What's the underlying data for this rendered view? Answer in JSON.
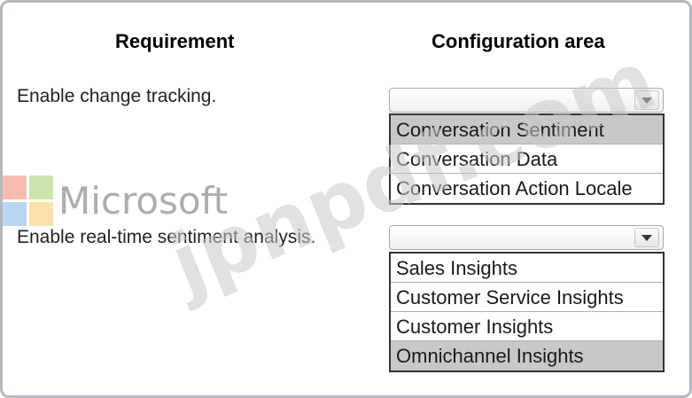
{
  "headers": {
    "requirement": "Requirement",
    "configuration": "Configuration area"
  },
  "rows": [
    {
      "requirement": "Enable change tracking.",
      "dropdown_value": "",
      "options": [
        {
          "label": "Conversation Sentiment",
          "selected": true
        },
        {
          "label": "Conversation Data",
          "selected": false
        },
        {
          "label": "Conversation Action Locale",
          "selected": false
        }
      ]
    },
    {
      "requirement": "Enable real-time sentiment analysis.",
      "dropdown_value": "",
      "options": [
        {
          "label": "Sales Insights",
          "selected": false
        },
        {
          "label": "Customer Service Insights",
          "selected": false
        },
        {
          "label": "Customer Insights",
          "selected": false
        },
        {
          "label": "Omnichannel Insights",
          "selected": true
        }
      ]
    }
  ],
  "watermark": {
    "logo_text": "Microsoft",
    "site_text": "jpnpdf.com",
    "logo_colors": [
      "#f3a08e",
      "#b7d98c",
      "#9cc7ef",
      "#f9d68a"
    ]
  },
  "colors": {
    "selected_option_bg": "#c8c8c8",
    "list_border": "#333333",
    "frame_border": "#b4b9bf"
  }
}
